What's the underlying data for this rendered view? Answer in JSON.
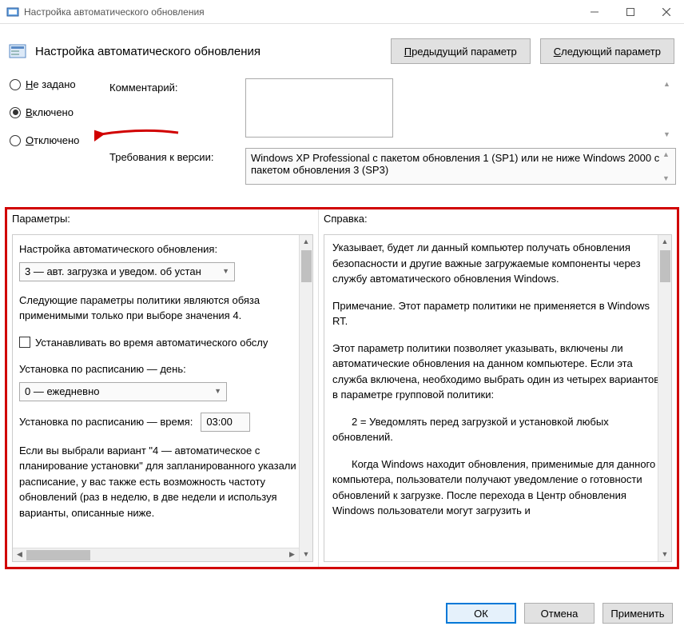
{
  "window": {
    "title": "Настройка автоматического обновления"
  },
  "header": {
    "name": "Настройка автоматического обновления",
    "prev_btn": "Предыдущий параметр",
    "next_btn": "Следующий параметр"
  },
  "radios": {
    "not_configured": "Не задано",
    "enabled": "Включено",
    "disabled": "Отключено",
    "selected": "enabled"
  },
  "comment": {
    "label": "Комментарий:",
    "value": ""
  },
  "requirements": {
    "label": "Требования к версии:",
    "text": "Windows XP Professional с пакетом обновления 1 (SP1) или не ниже Windows 2000 с пакетом обновления 3 (SP3)"
  },
  "params": {
    "header": "Параметры:",
    "config_label": "Настройка автоматического обновления:",
    "config_select": "3 — авт. загрузка и уведом. об устан",
    "note": "Следующие параметры политики являются обяза применимыми только при выборе значения 4.",
    "checkbox": "Устанавливать во время автоматического обслу",
    "day_label": "Установка по расписанию — день:",
    "day_select": "0 — ежедневно",
    "time_label": "Установка по расписанию — время:",
    "time_value": "03:00",
    "tail": "Если вы выбрали вариант \"4 — автоматическое с планирование установки\" для запланированного указали расписание, у вас также есть возможность частоту обновлений (раз в неделю, в две недели и используя варианты, описанные ниже."
  },
  "help": {
    "header": "Справка:",
    "p1": "Указывает, будет ли данный компьютер получать обновления безопасности и другие важные загружаемые компоненты через службу автоматического обновления Windows.",
    "p2": "Примечание. Этот параметр политики не применяется в Windows RT.",
    "p3": "Этот параметр политики позволяет указывать, включены ли автоматические обновления на данном компьютере. Если эта служба включена, необходимо выбрать один из четырех вариантов в параметре групповой политики:",
    "p4": "2 = Уведомлять перед загрузкой и установкой любых обновлений.",
    "p5": "Когда Windows находит обновления, применимые для данного компьютера, пользователи получают уведомление о готовности обновлений к загрузке. После перехода в Центр обновления Windows пользователи могут загрузить и"
  },
  "footer": {
    "ok": "ОК",
    "cancel": "Отмена",
    "apply": "Применить"
  }
}
